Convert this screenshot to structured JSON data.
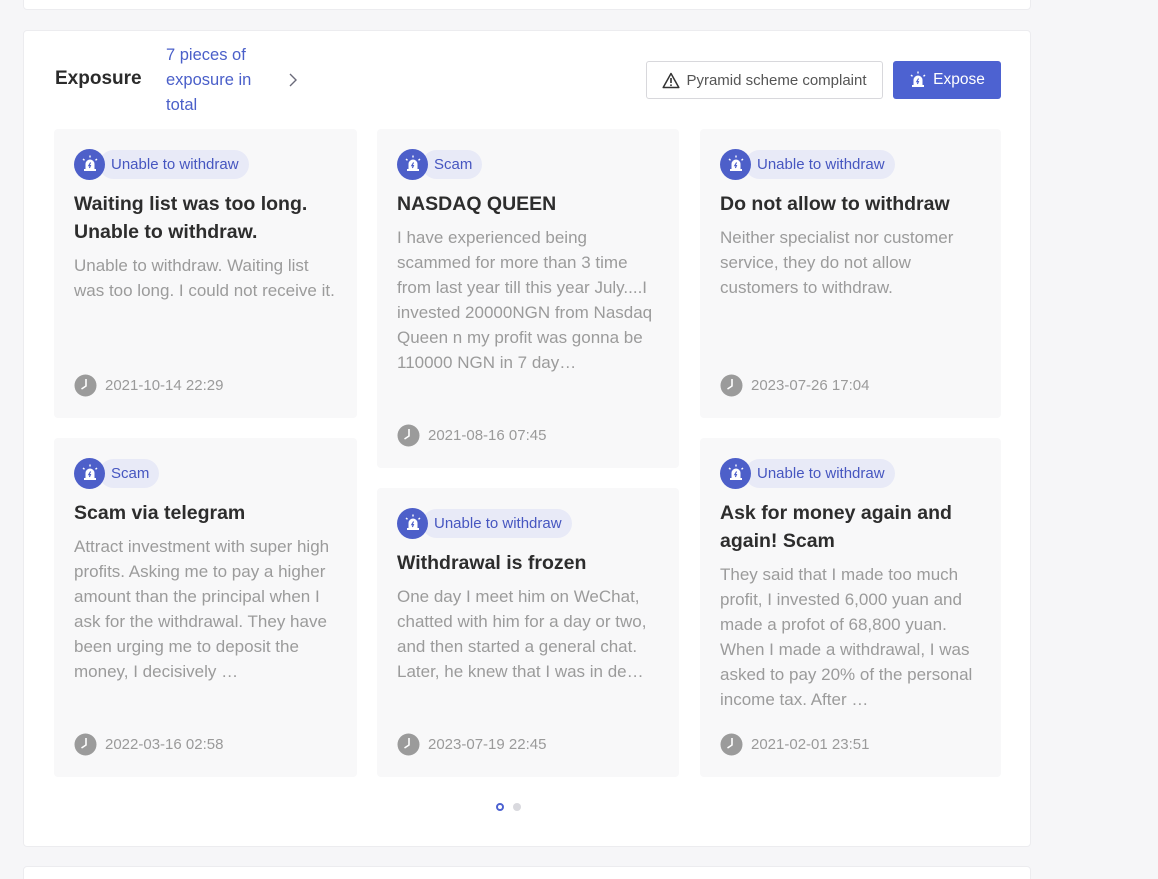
{
  "section": {
    "title": "Exposure",
    "summary": "7 pieces of exposure in total",
    "complaint_label": "Pyramid scheme complaint",
    "expose_label": "Expose"
  },
  "cards": [
    {
      "tag": "Unable to withdraw",
      "title": "Waiting list was too long. Unable to withdraw.",
      "text": "Unable to withdraw. Waiting list was too long. I could not receive it.",
      "time": "2021-10-14 22:29"
    },
    {
      "tag": "Scam",
      "title": "NASDAQ QUEEN",
      "text": "I have experienced being scammed for more than 3 time from last year till this year July....I invested 20000NGN  from Nasdaq Queen n my profit was gonna be 110000 NGN in 7 day…",
      "time": "2021-08-16 07:45"
    },
    {
      "tag": "Unable to withdraw",
      "title": "Do not allow to withdraw",
      "text": "Neither specialist nor customer service, they do not allow customers to withdraw.",
      "time": "2023-07-26 17:04"
    },
    {
      "tag": "Scam",
      "title": "Scam via telegram",
      "text": "Attract investment with super high profits. Asking me to pay a higher amount than the principal when I ask for the withdrawal. They have been urging me to deposit the money, I decisively …",
      "time": "2022-03-16 02:58"
    },
    {
      "tag": "Unable to withdraw",
      "title": "Withdrawal is frozen",
      "text": "One day I meet him on WeChat, chatted with him for a day or two, and then started a general chat. Later, he knew that I was in de…",
      "time": "2023-07-19 22:45"
    },
    {
      "tag": "Unable to withdraw",
      "title": "Ask for money again and again! Scam",
      "text": "They said that I made too much profit, I invested 6,000 yuan and made a profot of 68,800 yuan. When I made a withdrawal, I was asked to pay 20% of the personal income tax. After …",
      "time": "2021-02-01 23:51"
    }
  ],
  "pagination": {
    "pages": 2,
    "current": 1
  },
  "icons": {
    "tag": "alarm-siren-icon",
    "complaint": "warning-triangle-icon",
    "expose": "alarm-siren-icon",
    "time": "clock-icon",
    "summary": "chevron-right-icon"
  },
  "colors": {
    "accent": "#4d62d1",
    "tag_bg": "#e8eaf7",
    "muted_text": "#9b9b9b"
  }
}
